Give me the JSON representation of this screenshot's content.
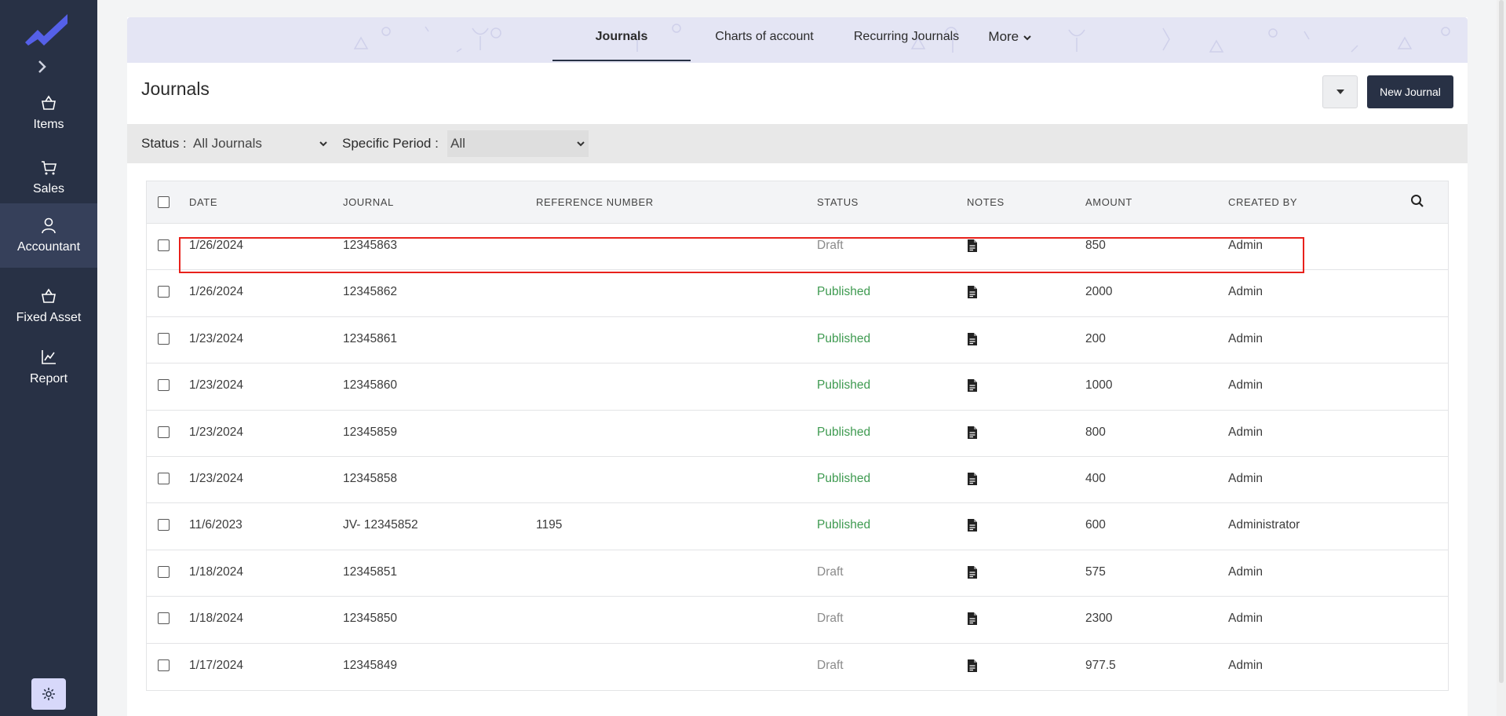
{
  "sidebar": {
    "items": [
      {
        "label": "Items",
        "icon": "basket-icon"
      },
      {
        "label": "Sales",
        "icon": "cart-icon"
      },
      {
        "label": "Accountant",
        "icon": "user-icon"
      },
      {
        "label": "Fixed Asset",
        "icon": "basket-icon"
      },
      {
        "label": "Report",
        "icon": "chart-icon"
      }
    ],
    "active": "Accountant"
  },
  "tabs": [
    {
      "label": "Journals"
    },
    {
      "label": "Charts of account"
    },
    {
      "label": "Recurring Journals"
    },
    {
      "label": "More"
    }
  ],
  "page": {
    "title": "Journals",
    "new_button": "New Journal"
  },
  "filters": {
    "status_label": "Status :",
    "status_value": "All Journals",
    "period_label": "Specific Period :",
    "period_value": "All"
  },
  "table": {
    "headers": [
      "DATE",
      "JOURNAL",
      "REFERENCE NUMBER",
      "STATUS",
      "NOTES",
      "AMOUNT",
      "CREATED BY"
    ],
    "rows": [
      {
        "date": "1/26/2024",
        "journal": "12345863",
        "ref": "",
        "status": "Draft",
        "amount": "850",
        "created_by": "Admin"
      },
      {
        "date": "1/26/2024",
        "journal": "12345862",
        "ref": "",
        "status": "Published",
        "amount": "2000",
        "created_by": "Admin"
      },
      {
        "date": "1/23/2024",
        "journal": "12345861",
        "ref": "",
        "status": "Published",
        "amount": "200",
        "created_by": "Admin"
      },
      {
        "date": "1/23/2024",
        "journal": "12345860",
        "ref": "",
        "status": "Published",
        "amount": "1000",
        "created_by": "Admin"
      },
      {
        "date": "1/23/2024",
        "journal": "12345859",
        "ref": "",
        "status": "Published",
        "amount": "800",
        "created_by": "Admin"
      },
      {
        "date": "1/23/2024",
        "journal": "12345858",
        "ref": "",
        "status": "Published",
        "amount": "400",
        "created_by": "Admin"
      },
      {
        "date": "11/6/2023",
        "journal": "JV- 12345852",
        "ref": "1195",
        "status": "Published",
        "amount": "600",
        "created_by": "Administrator"
      },
      {
        "date": "1/18/2024",
        "journal": "12345851",
        "ref": "",
        "status": "Draft",
        "amount": "575",
        "created_by": "Admin"
      },
      {
        "date": "1/18/2024",
        "journal": "12345850",
        "ref": "",
        "status": "Draft",
        "amount": "2300",
        "created_by": "Admin"
      },
      {
        "date": "1/17/2024",
        "journal": "12345849",
        "ref": "",
        "status": "Draft",
        "amount": "977.5",
        "created_by": "Admin"
      }
    ]
  },
  "colors": {
    "sidebar": "#283145",
    "accent": "#4f5bd5",
    "published": "#3e9a50",
    "draft": "#8b8b8b",
    "highlight": "#e8211b"
  }
}
